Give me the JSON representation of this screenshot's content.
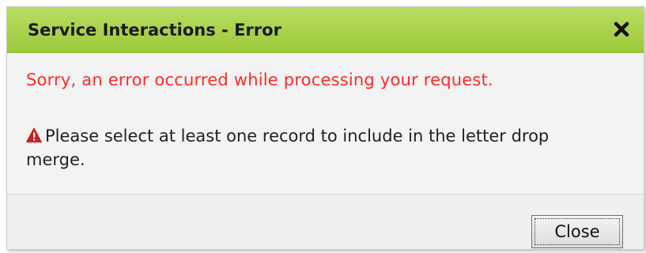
{
  "dialog": {
    "title": "Service Interactions - Error",
    "close_icon": "close-x-icon",
    "error_headline": "Sorry, an error occurred while processing your request.",
    "warning_icon": "warning-triangle-icon",
    "message": "Please select at least one record to include in the letter drop merge.",
    "close_button_label": "Close"
  },
  "colors": {
    "titlebar_green": "#a5d045",
    "error_red": "#ff2a2a",
    "warning_icon_red": "#cc1f1f",
    "dialog_background": "#f3f3f3"
  }
}
